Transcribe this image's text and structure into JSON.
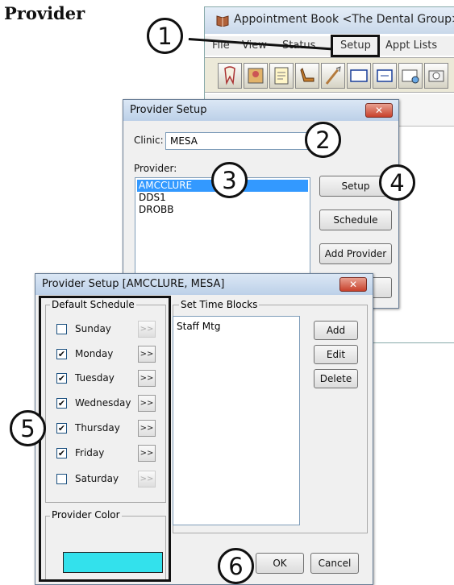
{
  "heading": "Provider",
  "appointment_book": {
    "title": "Appointment Book <The Dental Group>",
    "menu": [
      "File",
      "View",
      "Status",
      "Setup",
      "Appt Lists"
    ]
  },
  "provider_setup": {
    "title": "Provider Setup",
    "clinic_label": "Clinic:",
    "clinic_value": "MESA",
    "provider_label": "Provider:",
    "providers": [
      "AMCCLURE",
      "DDS1",
      "DROBB"
    ],
    "buttons": {
      "setup": "Setup",
      "schedule": "Schedule",
      "add_provider": "Add Provider"
    }
  },
  "provider_detail": {
    "title": "Provider Setup [AMCCLURE, MESA]",
    "default_schedule_label": "Default Schedule",
    "days": [
      {
        "name": "Sunday",
        "checked": false
      },
      {
        "name": "Monday",
        "checked": true
      },
      {
        "name": "Tuesday",
        "checked": true
      },
      {
        "name": "Wednesday",
        "checked": true
      },
      {
        "name": "Thursday",
        "checked": true
      },
      {
        "name": "Friday",
        "checked": true
      },
      {
        "name": "Saturday",
        "checked": false
      }
    ],
    "arrow_label": ">>",
    "set_time_blocks_label": "Set Time Blocks",
    "time_blocks": [
      "Staff Mtg"
    ],
    "buttons": {
      "add": "Add",
      "edit": "Edit",
      "delete": "Delete",
      "ok": "OK",
      "cancel": "Cancel"
    },
    "provider_color_label": "Provider Color",
    "provider_color": "#33e1ec"
  },
  "callouts": [
    "1",
    "2",
    "3",
    "4",
    "5",
    "6"
  ],
  "close_glyph": "✕",
  "check_glyph": "✔",
  "dropdown_glyph": "▼"
}
